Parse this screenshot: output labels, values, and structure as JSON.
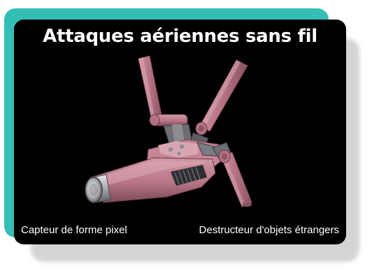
{
  "card": {
    "title": "Attaques aériennes sans fil",
    "left_caption": "Capteur de forme pixel",
    "right_caption": "Destructeur d'objets étrangers"
  },
  "colors": {
    "accent_teal": "#33bfb6",
    "card_background": "#000000",
    "device_pink": "#c07f8e",
    "text": "#ffffff"
  }
}
